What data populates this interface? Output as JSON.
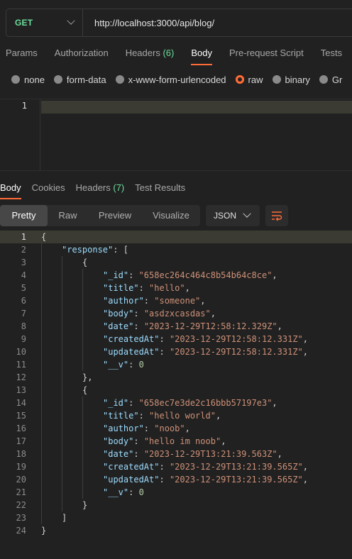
{
  "request": {
    "method": "GET",
    "url": "http://localhost:3000/api/blog/",
    "tabs": [
      {
        "label": "Params"
      },
      {
        "label": "Authorization"
      },
      {
        "label": "Headers",
        "count": "(6)"
      },
      {
        "label": "Body"
      },
      {
        "label": "Pre-request Script"
      },
      {
        "label": "Tests"
      }
    ],
    "active_tab": "Body",
    "body_types": [
      "none",
      "form-data",
      "x-www-form-urlencoded",
      "raw",
      "binary",
      "Gr"
    ],
    "selected_body_type": "raw",
    "editor_line_number": "1"
  },
  "response": {
    "tabs": [
      {
        "label": "Body"
      },
      {
        "label": "Cookies"
      },
      {
        "label": "Headers",
        "count": "(7)"
      },
      {
        "label": "Test Results"
      }
    ],
    "active_tab": "Body",
    "view_modes": [
      "Pretty",
      "Raw",
      "Preview",
      "Visualize"
    ],
    "active_view_mode": "Pretty",
    "format": "JSON",
    "lines": [
      [
        [
          "p",
          "{"
        ]
      ],
      [
        [
          "k",
          "\"response\""
        ],
        [
          "p",
          ": ["
        ]
      ],
      [
        [
          "p",
          "{"
        ]
      ],
      [
        [
          "k",
          "\"_id\""
        ],
        [
          "p",
          ": "
        ],
        [
          "s",
          "\"658ec264c464c8b54b64c8ce\""
        ],
        [
          "p",
          ","
        ]
      ],
      [
        [
          "k",
          "\"title\""
        ],
        [
          "p",
          ": "
        ],
        [
          "s",
          "\"hello\""
        ],
        [
          "p",
          ","
        ]
      ],
      [
        [
          "k",
          "\"author\""
        ],
        [
          "p",
          ": "
        ],
        [
          "s",
          "\"someone\""
        ],
        [
          "p",
          ","
        ]
      ],
      [
        [
          "k",
          "\"body\""
        ],
        [
          "p",
          ": "
        ],
        [
          "s",
          "\"asdzxcasdas\""
        ],
        [
          "p",
          ","
        ]
      ],
      [
        [
          "k",
          "\"date\""
        ],
        [
          "p",
          ": "
        ],
        [
          "s",
          "\"2023-12-29T12:58:12.329Z\""
        ],
        [
          "p",
          ","
        ]
      ],
      [
        [
          "k",
          "\"createdAt\""
        ],
        [
          "p",
          ": "
        ],
        [
          "s",
          "\"2023-12-29T12:58:12.331Z\""
        ],
        [
          "p",
          ","
        ]
      ],
      [
        [
          "k",
          "\"updatedAt\""
        ],
        [
          "p",
          ": "
        ],
        [
          "s",
          "\"2023-12-29T12:58:12.331Z\""
        ],
        [
          "p",
          ","
        ]
      ],
      [
        [
          "k",
          "\"__v\""
        ],
        [
          "p",
          ": "
        ],
        [
          "n",
          "0"
        ]
      ],
      [
        [
          "p",
          "},"
        ]
      ],
      [
        [
          "p",
          "{"
        ]
      ],
      [
        [
          "k",
          "\"_id\""
        ],
        [
          "p",
          ": "
        ],
        [
          "s",
          "\"658ec7e3de2c16bbb57197e3\""
        ],
        [
          "p",
          ","
        ]
      ],
      [
        [
          "k",
          "\"title\""
        ],
        [
          "p",
          ": "
        ],
        [
          "s",
          "\"hello world\""
        ],
        [
          "p",
          ","
        ]
      ],
      [
        [
          "k",
          "\"author\""
        ],
        [
          "p",
          ": "
        ],
        [
          "s",
          "\"noob\""
        ],
        [
          "p",
          ","
        ]
      ],
      [
        [
          "k",
          "\"body\""
        ],
        [
          "p",
          ": "
        ],
        [
          "s",
          "\"hello im noob\""
        ],
        [
          "p",
          ","
        ]
      ],
      [
        [
          "k",
          "\"date\""
        ],
        [
          "p",
          ": "
        ],
        [
          "s",
          "\"2023-12-29T13:21:39.563Z\""
        ],
        [
          "p",
          ","
        ]
      ],
      [
        [
          "k",
          "\"createdAt\""
        ],
        [
          "p",
          ": "
        ],
        [
          "s",
          "\"2023-12-29T13:21:39.565Z\""
        ],
        [
          "p",
          ","
        ]
      ],
      [
        [
          "k",
          "\"updatedAt\""
        ],
        [
          "p",
          ": "
        ],
        [
          "s",
          "\"2023-12-29T13:21:39.565Z\""
        ],
        [
          "p",
          ","
        ]
      ],
      [
        [
          "k",
          "\"__v\""
        ],
        [
          "p",
          ": "
        ],
        [
          "n",
          "0"
        ]
      ],
      [
        [
          "p",
          "}"
        ]
      ],
      [
        [
          "p",
          "]"
        ]
      ],
      [
        [
          "p",
          "}"
        ]
      ]
    ]
  },
  "colors": {
    "accent": "#ff6c37",
    "method_green": "#6bdd9a",
    "json_key": "#9cdcfe",
    "json_string": "#ce9178",
    "json_number": "#b5cea8"
  }
}
